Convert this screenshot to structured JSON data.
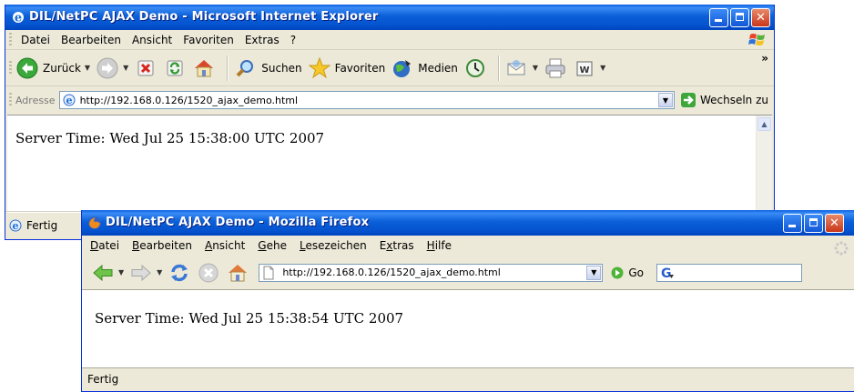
{
  "ie": {
    "title": "DIL/NetPC AJAX Demo - Microsoft Internet Explorer",
    "menu": [
      "Datei",
      "Bearbeiten",
      "Ansicht",
      "Favoriten",
      "Extras",
      "?"
    ],
    "toolbar": {
      "back": "Zurück",
      "search": "Suchen",
      "favorites": "Favoriten",
      "media": "Medien",
      "overflow": "»"
    },
    "address_label": "Adresse",
    "url": "http://192.168.0.126/1520_ajax_demo.html",
    "go_label": "Wechseln zu",
    "content_text": "Server Time: Wed Jul 25 15:38:00 UTC 2007",
    "status": "Fertig"
  },
  "ff": {
    "title": "DIL/NetPC AJAX Demo - Mozilla Firefox",
    "menu": [
      {
        "pre": "",
        "u": "D",
        "post": "atei"
      },
      {
        "pre": "",
        "u": "B",
        "post": "earbeiten"
      },
      {
        "pre": "",
        "u": "A",
        "post": "nsicht"
      },
      {
        "pre": "",
        "u": "G",
        "post": "ehe"
      },
      {
        "pre": "",
        "u": "L",
        "post": "esezeichen"
      },
      {
        "pre": "E",
        "u": "x",
        "post": "tras"
      },
      {
        "pre": "",
        "u": "H",
        "post": "ilfe"
      }
    ],
    "url": "http://192.168.0.126/1520_ajax_demo.html",
    "go_label": "Go",
    "content_text": "Server Time: Wed Jul 25 15:38:54 UTC 2007",
    "status": "Fertig"
  },
  "colors": {
    "titlebar": "#0553cf",
    "chrome": "#ece9d8",
    "close_button": "#c9361a"
  },
  "icons": [
    "ie-logo-icon",
    "windows-flag-icon",
    "back-icon",
    "forward-icon",
    "stop-icon",
    "refresh-icon",
    "home-icon",
    "search-icon",
    "favorites-star-icon",
    "media-icon",
    "history-icon",
    "mail-icon",
    "print-icon",
    "edit-icon",
    "page-icon",
    "go-arrow-icon",
    "firefox-logo-icon",
    "google-icon",
    "throbber-icon"
  ]
}
